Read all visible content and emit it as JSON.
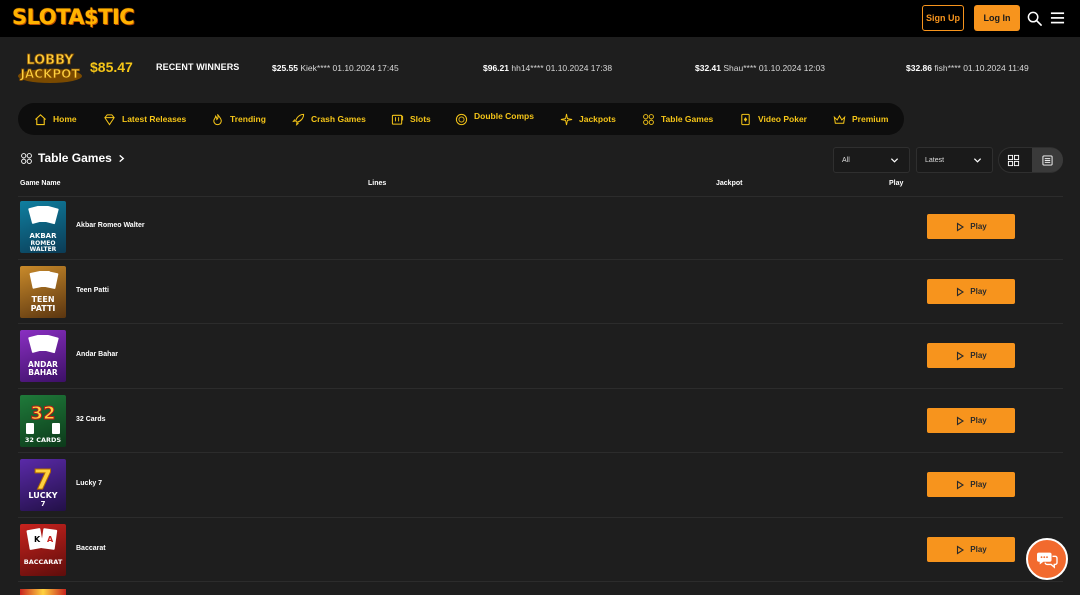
{
  "header": {
    "logo": "SLOTA$TIC",
    "signup_label": "Sign Up",
    "login_label": "Log In",
    "icons": [
      "search-icon",
      "menu-icon"
    ]
  },
  "jackpot": {
    "logo_line1": "LOBBY",
    "logo_line2": "JACKPOT",
    "balance": "$85.47"
  },
  "winners": {
    "label": "RECENT WINNERS",
    "items": [
      {
        "amount": "$25.55",
        "info": "Kiek**** 01.10.2024 17:45"
      },
      {
        "amount": "$96.21",
        "info": "hh14**** 01.10.2024 17:38"
      },
      {
        "amount": "$32.41",
        "info": "Shau**** 01.10.2024 12:03"
      },
      {
        "amount": "$32.86",
        "info": "fish**** 01.10.2024 11:49"
      }
    ]
  },
  "nav": {
    "items": [
      {
        "label": "Home",
        "icon": "home-icon"
      },
      {
        "label": "Latest Releases",
        "icon": "diamond-icon"
      },
      {
        "label": "Trending",
        "icon": "flame-icon"
      },
      {
        "label": "Crash Games",
        "icon": "rocket-icon"
      },
      {
        "label": "Slots",
        "icon": "slot-machine-icon"
      },
      {
        "label": "Double Comps",
        "icon": "coin-icon"
      },
      {
        "label": "Jackpots",
        "icon": "sparkle-icon"
      },
      {
        "label": "Table Games",
        "icon": "cards-icon"
      },
      {
        "label": "Video Poker",
        "icon": "video-poker-icon"
      },
      {
        "label": "Premium",
        "icon": "crown-icon"
      }
    ]
  },
  "section": {
    "title": "Table Games",
    "filter_value": "All",
    "sort_value": "Latest"
  },
  "table": {
    "columns": [
      "Game Name",
      "Lines",
      "Jackpot",
      "Play"
    ],
    "play_label": "Play",
    "rows": [
      {
        "name": "Akbar Romeo Walter",
        "thumb_text": "AKBAR ROMEO WALTER",
        "colors": [
          "#0f7fa0",
          "#0b3b55"
        ]
      },
      {
        "name": "Teen Patti",
        "thumb_text": "TEEN PATTI",
        "colors": [
          "#c98a2a",
          "#5a3510"
        ]
      },
      {
        "name": "Andar Bahar",
        "thumb_text": "ANDAR BAHAR",
        "colors": [
          "#8a2fc2",
          "#3c1066"
        ]
      },
      {
        "name": "32 Cards",
        "thumb_text": "32 CARDS",
        "colors": [
          "#1f7a3a",
          "#0c3a1a"
        ]
      },
      {
        "name": "Lucky 7",
        "thumb_text": "LUCKY 7",
        "colors": [
          "#5a2aa8",
          "#221047"
        ]
      },
      {
        "name": "Baccarat",
        "thumb_text": "BACCARAT",
        "colors": [
          "#c8231e",
          "#5e0d0b"
        ]
      }
    ]
  },
  "colors": {
    "accent": "#f7941d",
    "gold": "#f5c518",
    "background": "#1e1e1e",
    "header": "#000000",
    "chat": "#f26a2e"
  }
}
